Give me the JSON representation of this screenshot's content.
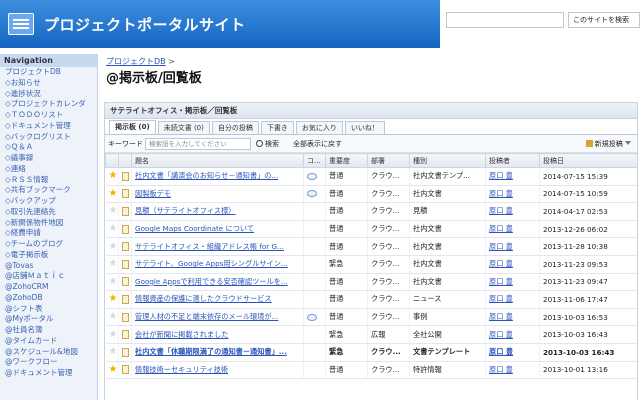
{
  "header": {
    "site_title": "プロジェクトポータルサイト",
    "search_placeholder": "",
    "scope_label": "このサイトを検索"
  },
  "nav": {
    "title": "Navigation",
    "items": [
      "プロジェクトDB",
      "◇お知らせ",
      "◇進捗状況",
      "◇プロジェクトカレンダ",
      "◇ＴＯＤＯリスト",
      "◇ドキュメント管理",
      "◇バックログリスト",
      "◇Ｑ＆Ａ",
      "◇議事録",
      "◇連絡",
      "◇ＲＳＳ情報",
      "◇共有ブックマーク",
      "◇バックアップ",
      "◇取引先連絡先",
      "◇新関係物件地図",
      "◇経費申請",
      "◇チームのブログ",
      "◇電子掲示板",
      "@Tovas",
      "@店舗Ｍａｔｉｃ",
      "@ZohoCRM",
      "@ZohoDB",
      "@シフト表",
      "@Myポータル",
      "@社員名簿",
      "@タイムカード",
      "@スケジュール&地図",
      "@ワークフロー",
      "@ドキュメント管理"
    ]
  },
  "breadcrumb": {
    "link": "プロジェクトDB",
    "sep": ">"
  },
  "page_title": "@掲示板/回覧板",
  "board": {
    "title": "サテライトオフィス・掲示板／回覧板",
    "tabs": [
      "掲示板 (0)",
      "未読文書 (0)",
      "自分の投稿",
      "下書き",
      "お気に入り",
      "いいね！"
    ],
    "keyword_label": "キーワード",
    "keyword_placeholder": "検索語を入力してください",
    "search_label": "検索",
    "show_all_label": "全部表示に戻す",
    "new_post_label": "新規投稿",
    "columns": [
      "",
      "",
      "題名",
      "コ...",
      "重要度",
      "部署",
      "種別",
      "投稿者",
      "投稿日"
    ],
    "rows": [
      {
        "star": true,
        "subject": "社内文書「講演会のお知らせ－通知書」の...",
        "comment": true,
        "importance": "普通",
        "dept": "クラウ...",
        "type": "社内文書テンプ...",
        "poster": "原口 豊",
        "date": "2014-07-15 15:39",
        "bold": false
      },
      {
        "star": true,
        "subject": "図製板デモ",
        "comment": true,
        "importance": "普通",
        "dept": "クラウ...",
        "type": "社内文書",
        "poster": "原口 豊",
        "date": "2014-07-15 10:59",
        "bold": false
      },
      {
        "star": false,
        "subject": "見積（サテライトオフィス様）",
        "comment": false,
        "importance": "普通",
        "dept": "クラウ...",
        "type": "見積",
        "poster": "原口 豊",
        "date": "2014-04-17 02:53",
        "bold": false
      },
      {
        "star": false,
        "subject": "Google Maps Coordinate について",
        "comment": false,
        "importance": "普通",
        "dept": "クラウ...",
        "type": "社内文書",
        "poster": "原口 豊",
        "date": "2013-12-26 06:02",
        "bold": false
      },
      {
        "star": false,
        "subject": "サテライトオフィス・組織アドレス帳 for G...",
        "comment": false,
        "importance": "普通",
        "dept": "クラウ...",
        "type": "社内文書",
        "poster": "原口 豊",
        "date": "2013-11-28 10:38",
        "bold": false
      },
      {
        "star": false,
        "subject": "サテライト、Google Apps用シングルサイン...",
        "comment": false,
        "importance": "緊急",
        "dept": "クラウ...",
        "type": "社内文書",
        "poster": "原口 豊",
        "date": "2013-11-23 09:53",
        "bold": false
      },
      {
        "star": false,
        "subject": "Google Appsで利用できる安否確認ツールを...",
        "comment": false,
        "importance": "普通",
        "dept": "クラウ...",
        "type": "社内文書",
        "poster": "原口 豊",
        "date": "2013-11-23 09:47",
        "bold": false
      },
      {
        "star": true,
        "subject": "情報資産の保護に適したクラウドサービス",
        "comment": false,
        "importance": "普通",
        "dept": "クラウ...",
        "type": "ニュース",
        "poster": "原口 豊",
        "date": "2013-11-06 17:47",
        "bold": false
      },
      {
        "star": false,
        "subject": "管理人材の不足と端末依存のメール環境が...",
        "comment": true,
        "importance": "普通",
        "dept": "クラウ...",
        "type": "事例",
        "poster": "原口 豊",
        "date": "2013-10-03 16:53",
        "bold": false
      },
      {
        "star": false,
        "subject": "会社が新聞に掲載されました",
        "comment": false,
        "importance": "緊急",
        "dept": "広報",
        "type": "全社公開",
        "poster": "原口 豊",
        "date": "2013-10-03 16:43",
        "bold": false
      },
      {
        "star": false,
        "subject": "社内文書「休職期限満了の通知書－通知書」...",
        "comment": false,
        "importance": "緊急",
        "dept": "クラウ...",
        "type": "文書テンプレート",
        "poster": "原口 豊",
        "date": "2013-10-03 16:43",
        "bold": true
      },
      {
        "star": true,
        "subject": "情報技術ーセキュリティ技術",
        "comment": false,
        "importance": "普通",
        "dept": "クラウ...",
        "type": "特許情報",
        "poster": "原口 豊",
        "date": "2013-10-01 13:16",
        "bold": false
      }
    ]
  }
}
